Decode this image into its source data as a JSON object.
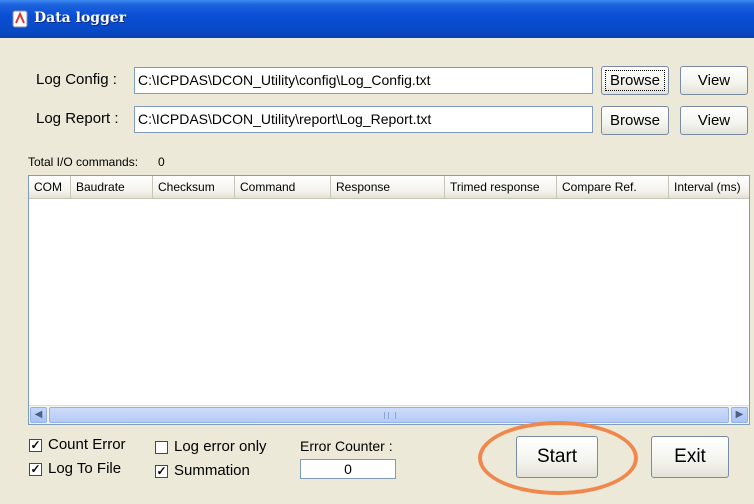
{
  "window": {
    "title": "Data logger",
    "colors": {
      "titlebar": "#0a4fd6",
      "face": "#ece9d8",
      "highlight_ring": "#f0884d"
    }
  },
  "log_config": {
    "label": "Log Config :",
    "value": "C:\\ICPDAS\\DCON_Utility\\config\\Log_Config.txt",
    "browse_label": "Browse",
    "view_label": "View"
  },
  "log_report": {
    "label": "Log Report :",
    "value": "C:\\ICPDAS\\DCON_Utility\\report\\Log_Report.txt",
    "browse_label": "Browse",
    "view_label": "View"
  },
  "total_commands": {
    "label": "Total I/O commands:",
    "value": "0"
  },
  "table": {
    "columns": [
      "COM",
      "Baudrate",
      "Checksum",
      "Command",
      "Response",
      "Trimed response",
      "Compare Ref.",
      "Interval (ms)"
    ],
    "rows": []
  },
  "options": {
    "count_error": {
      "label": "Count Error",
      "checked": true
    },
    "log_to_file": {
      "label": "Log To File",
      "checked": true
    },
    "log_error_only": {
      "label": "Log error only",
      "checked": false
    },
    "summation": {
      "label": "Summation",
      "checked": true
    }
  },
  "error_counter": {
    "label": "Error Counter :",
    "value": "0"
  },
  "actions": {
    "start_label": "Start",
    "exit_label": "Exit"
  },
  "icons": {
    "title": "app-icon",
    "scroll_left": "arrow-left-icon",
    "scroll_right": "arrow-right-icon",
    "check": "checkmark-icon"
  }
}
